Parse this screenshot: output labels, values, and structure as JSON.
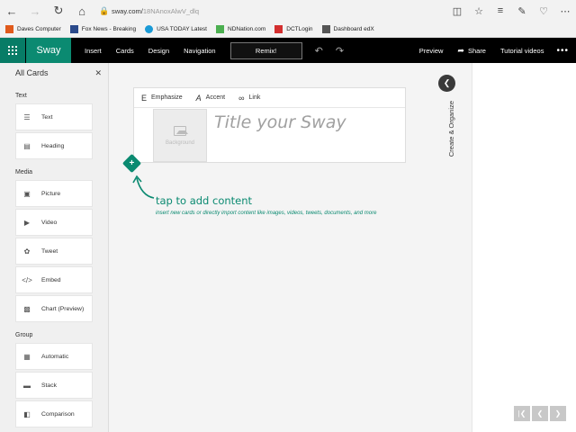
{
  "browser": {
    "url_host": "sway.com/",
    "url_path": "18NAnoxAlwV_dlq",
    "favorites": [
      {
        "label": "Daves Computer",
        "color": "#e05a1c"
      },
      {
        "label": "Fox News - Breaking",
        "color": "#2b4a8b"
      },
      {
        "label": "USA TODAY Latest",
        "color": "#1a9ad6"
      },
      {
        "label": "NDNation.com",
        "color": "#4caf50"
      },
      {
        "label": "DCTLogin",
        "color": "#d32f2f"
      },
      {
        "label": "Dashboard edX",
        "color": "#555555"
      }
    ]
  },
  "header": {
    "brand": "Sway",
    "menu": [
      "Insert",
      "Cards",
      "Design",
      "Navigation"
    ],
    "remix": "Remix!",
    "preview": "Preview",
    "share": "Share",
    "tutorial": "Tutorial videos",
    "accent_color": "#0b8a71"
  },
  "left_panel": {
    "title": "All Cards",
    "sections": [
      {
        "name": "Text",
        "items": [
          {
            "label": "Text",
            "icon": "lines-icon"
          },
          {
            "label": "Heading",
            "icon": "heading-icon"
          }
        ]
      },
      {
        "name": "Media",
        "items": [
          {
            "label": "Picture",
            "icon": "picture-icon"
          },
          {
            "label": "Video",
            "icon": "video-icon"
          },
          {
            "label": "Tweet",
            "icon": "twitter-icon"
          },
          {
            "label": "Embed",
            "icon": "code-icon"
          },
          {
            "label": "Chart (Preview)",
            "icon": "chart-icon"
          }
        ]
      },
      {
        "name": "Group",
        "items": [
          {
            "label": "Automatic",
            "icon": "automatic-icon"
          },
          {
            "label": "Stack",
            "icon": "stack-icon"
          },
          {
            "label": "Comparison",
            "icon": "comparison-icon"
          }
        ]
      }
    ]
  },
  "canvas": {
    "toolbar": {
      "emphasize": "Emphasize",
      "accent": "Accent",
      "link": "Link"
    },
    "background_label": "Background",
    "title_placeholder": "Title your Sway",
    "hint_title": "tap to add content",
    "hint_sub": "insert new cards or directly import content like images, videos, tweets, documents, and more",
    "organize_label": "Create & Organize"
  }
}
